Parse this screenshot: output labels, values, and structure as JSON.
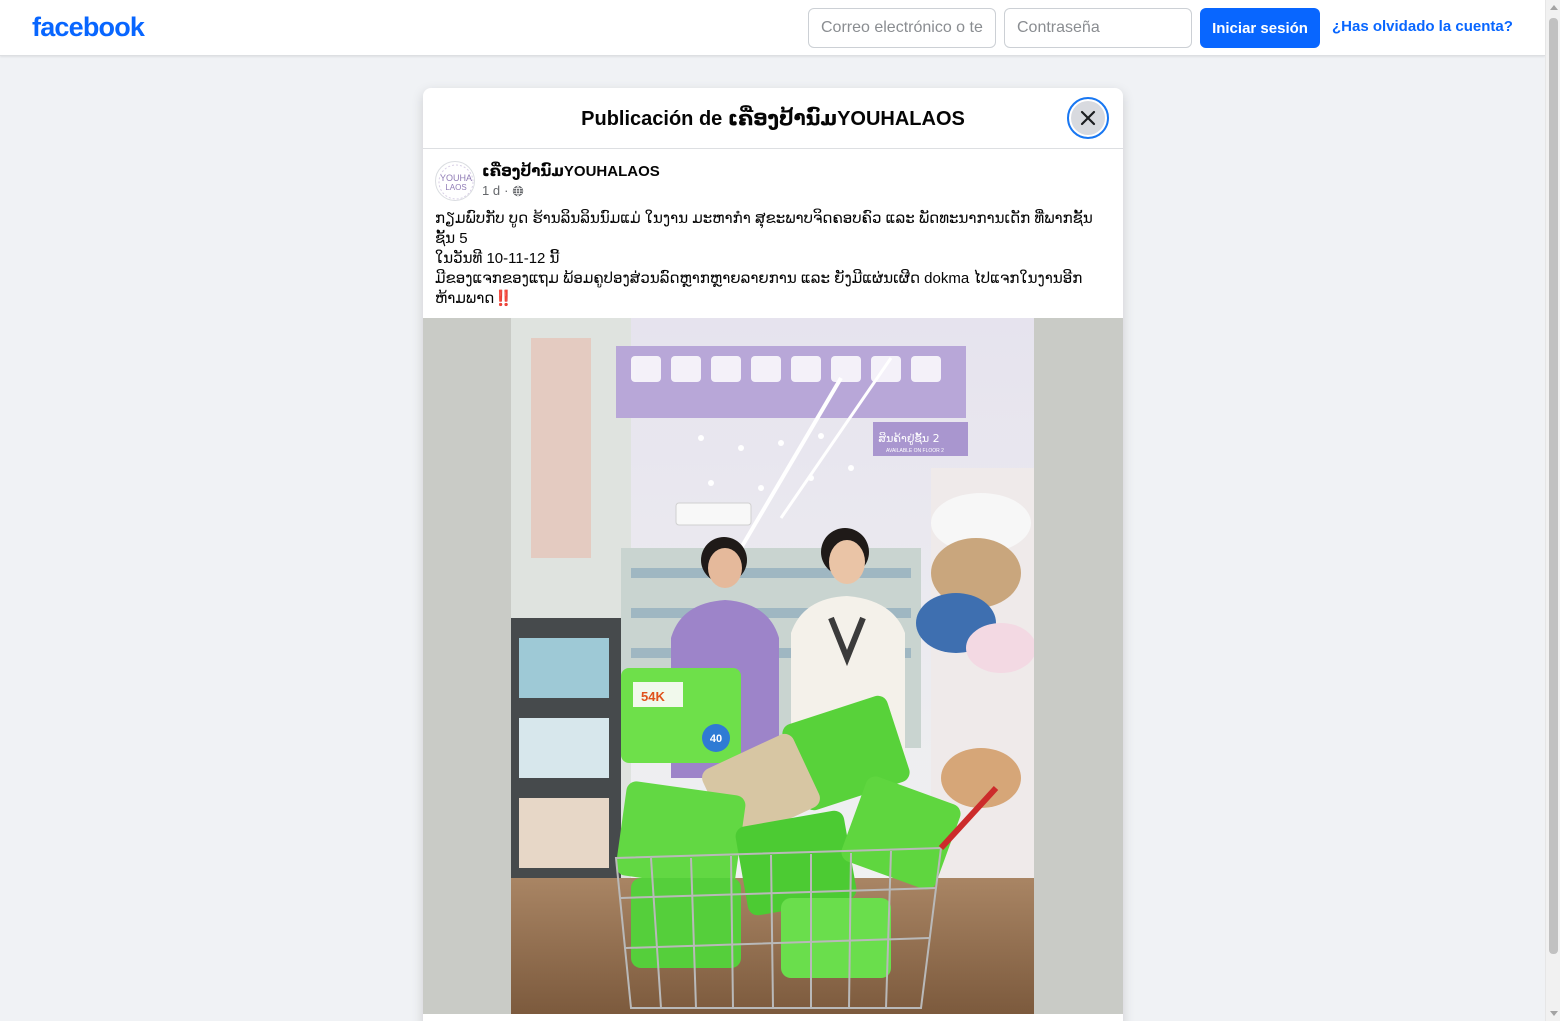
{
  "topbar": {
    "logo": "facebook",
    "email_placeholder": "Correo electrónico o teléfono",
    "password_placeholder": "Contraseña",
    "login_label": "Iniciar sesión",
    "forgot_label": "¿Has olvidado la cuenta?"
  },
  "modal": {
    "title": "Publicación de ເຄື່ອງປ້ານົມYOUHALAOS"
  },
  "post": {
    "page_name": "ເຄື່ອງປ້ານົມYOUHALAOS",
    "avatar_text": "YOUHA LAOS",
    "time": "1 d",
    "separator": "·",
    "text_lines": [
      "ກຽມພົບກັບ ບູດ ຮ້ານລິນລິນນົມແມ່ ໃນງານ ມະຫາກຳ ສຸຂະພາບຈິດຄອບຄົວ ແລະ ພັດທະນາການເດັກ ທີ່ພາກຊັ້ນ ຊັ້ນ 5",
      "ໃນວັນທີ 10-11-12 ນີ້",
      "ມີຂອງແຈກຂອງແຖມ ພ້ອມຄູປອງສ່ວນລົດຫຼາກຫຼາຍລາຍການ ແລະ ຍັງມີແຜ່ນເຜີດ dokma ໄປແຈກໃນງານອີກ ຫ້າມພາດ"
    ],
    "emphasis": "‼️"
  },
  "photo": {
    "sign_text": "ສິນຄ້າຢູ່ຊັ້ນ 2",
    "sign_subtext": "AVAILABLE ON FLOOR 2",
    "pack_label_a": "54K",
    "pack_label_b": "40"
  },
  "colors": {
    "brand": "#0866ff",
    "page_bg": "#f0f2f5"
  },
  "icons": [
    "globe-icon",
    "close-icon"
  ]
}
